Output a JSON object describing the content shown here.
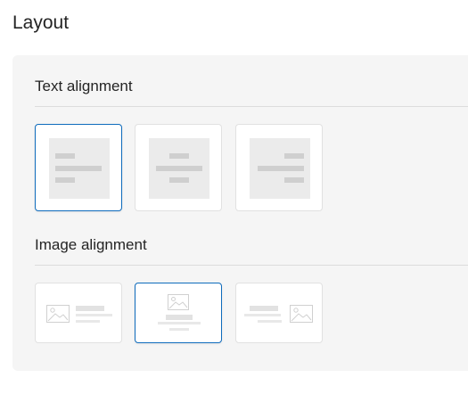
{
  "page": {
    "title": "Layout"
  },
  "text_alignment": {
    "title": "Text alignment",
    "options": [
      {
        "name": "left",
        "selected": true,
        "icon": "text-align-left-icon"
      },
      {
        "name": "center",
        "selected": false,
        "icon": "text-align-center-icon"
      },
      {
        "name": "right",
        "selected": false,
        "icon": "text-align-right-icon"
      }
    ]
  },
  "image_alignment": {
    "title": "Image alignment",
    "options": [
      {
        "name": "left",
        "selected": false,
        "icon": "image-left-icon"
      },
      {
        "name": "top",
        "selected": true,
        "icon": "image-top-icon"
      },
      {
        "name": "right",
        "selected": false,
        "icon": "image-right-icon"
      }
    ]
  },
  "colors": {
    "selected_border": "#0f6cbd",
    "panel_bg": "#f5f5f5"
  }
}
